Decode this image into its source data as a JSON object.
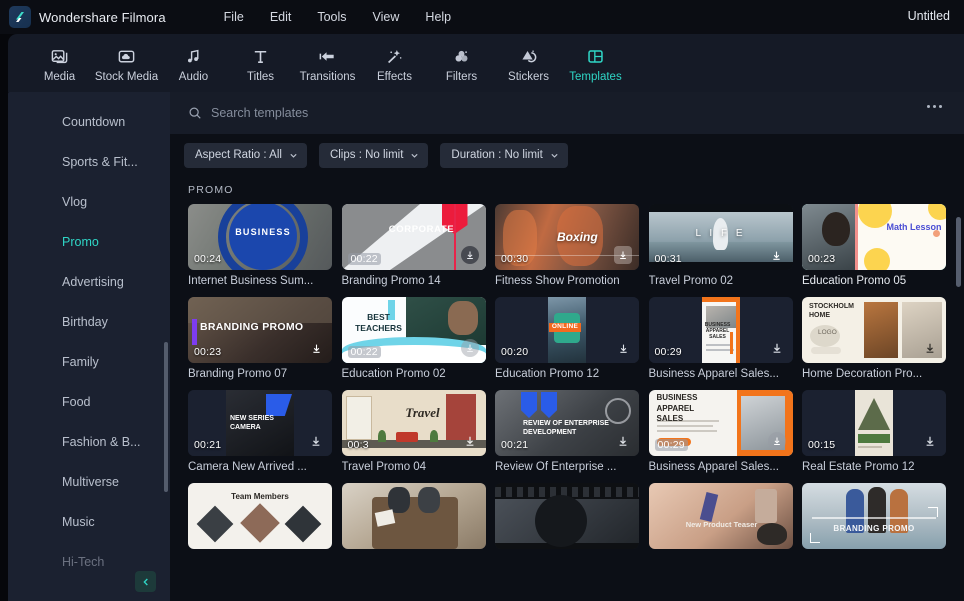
{
  "titlebar": {
    "app_name": "Wondershare Filmora",
    "logo_icon": "filmora-logo-icon",
    "menus": [
      "File",
      "Edit",
      "Tools",
      "View",
      "Help"
    ],
    "project_title": "Untitled"
  },
  "toolbar": {
    "items": [
      {
        "label": "Media",
        "icon": "media-image-icon",
        "active": false
      },
      {
        "label": "Stock Media",
        "icon": "stock-media-cloud-icon",
        "active": false
      },
      {
        "label": "Audio",
        "icon": "audio-note-icon",
        "active": false
      },
      {
        "label": "Titles",
        "icon": "titles-text-icon",
        "active": false
      },
      {
        "label": "Transitions",
        "icon": "transitions-arrow-icon",
        "active": false
      },
      {
        "label": "Effects",
        "icon": "effects-wand-icon",
        "active": false
      },
      {
        "label": "Filters",
        "icon": "filters-circles-icon",
        "active": false
      },
      {
        "label": "Stickers",
        "icon": "stickers-icon",
        "active": false
      },
      {
        "label": "Templates",
        "icon": "templates-layout-icon",
        "active": true
      }
    ],
    "active_index": 8
  },
  "sidebar": {
    "items": [
      {
        "label": "Countdown",
        "active": false,
        "faded": false
      },
      {
        "label": "Sports & Fit...",
        "active": false,
        "faded": false
      },
      {
        "label": "Vlog",
        "active": false,
        "faded": false
      },
      {
        "label": "Promo",
        "active": true,
        "faded": false
      },
      {
        "label": "Advertising",
        "active": false,
        "faded": false
      },
      {
        "label": "Birthday",
        "active": false,
        "faded": false
      },
      {
        "label": "Family",
        "active": false,
        "faded": false
      },
      {
        "label": "Food",
        "active": false,
        "faded": false
      },
      {
        "label": "Fashion & B...",
        "active": false,
        "faded": false
      },
      {
        "label": "Multiverse",
        "active": false,
        "faded": false
      },
      {
        "label": "Music",
        "active": false,
        "faded": false
      },
      {
        "label": "Hi-Tech",
        "active": false,
        "faded": true
      }
    ],
    "collapse_icon": "chevron-left-icon"
  },
  "search": {
    "placeholder": "Search templates",
    "value": "",
    "icon": "search-icon",
    "more_icon": "more-options-icon"
  },
  "filters": [
    {
      "label": "Aspect Ratio : All",
      "icon": "chevron-down-icon"
    },
    {
      "label": "Clips : No limit",
      "icon": "chevron-down-icon"
    },
    {
      "label": "Duration : No limit",
      "icon": "chevron-down-icon"
    }
  ],
  "grid": {
    "section_label": "PROMO",
    "download_icon": "download-icon",
    "cards": [
      {
        "title": "Internet Business Sum...",
        "duration": "00:24",
        "selected": false,
        "has_download": false,
        "boxed": false,
        "art": "business-circle",
        "caption": "BUSINESS"
      },
      {
        "title": "Branding Promo 14",
        "duration": "00:22",
        "selected": false,
        "has_download": true,
        "boxed": true,
        "art": "corporate",
        "caption": "CORPORATE"
      },
      {
        "title": "Fitness Show Promotion",
        "duration": "00:30",
        "selected": false,
        "has_download": true,
        "boxed": false,
        "art": "boxing",
        "caption": "Boxing"
      },
      {
        "title": "Travel Promo 02",
        "duration": "00:31",
        "selected": false,
        "has_download": true,
        "boxed": false,
        "art": "life",
        "caption": "L I F E"
      },
      {
        "title": "Education Promo 05",
        "duration": "00:23",
        "selected": true,
        "has_download": false,
        "boxed": false,
        "art": "math-lesson",
        "caption": "Math Lesson"
      },
      {
        "title": "Branding Promo 07",
        "duration": "00:23",
        "selected": false,
        "has_download": true,
        "boxed": false,
        "art": "branding-promo",
        "caption": "BRANDING PROMO"
      },
      {
        "title": "Education Promo 02",
        "duration": "00:22",
        "selected": false,
        "has_download": true,
        "boxed": true,
        "art": "best-teachers",
        "caption": "BEST TEACHERS"
      },
      {
        "title": "Education Promo 12",
        "duration": "00:20",
        "selected": false,
        "has_download": true,
        "boxed": false,
        "art": "online-vertical",
        "caption": "ONLINE"
      },
      {
        "title": "Business Apparel Sales...",
        "duration": "00:29",
        "selected": false,
        "has_download": true,
        "boxed": false,
        "art": "apparel-vertical",
        "caption": "BUSINESS APPAREL SALES"
      },
      {
        "title": "Home Decoration Pro...",
        "duration": "",
        "selected": false,
        "has_download": true,
        "boxed": false,
        "art": "stockholm-home",
        "caption": "STOCKHOLM HOME"
      },
      {
        "title": "Camera New Arrived ...",
        "duration": "00:21",
        "selected": false,
        "has_download": true,
        "boxed": false,
        "art": "new-series-camera",
        "caption": "NEW SERIES CAMERA"
      },
      {
        "title": "Travel Promo 04",
        "duration": "00:3",
        "selected": false,
        "has_download": true,
        "boxed": false,
        "art": "travel-illustration",
        "caption": "Travel"
      },
      {
        "title": "Review Of Enterprise ...",
        "duration": "00:21",
        "selected": false,
        "has_download": true,
        "boxed": false,
        "art": "enterprise-review",
        "caption": "REVIEW OF ENTERPRISE DEVELOPMENT"
      },
      {
        "title": "Business Apparel Sales...",
        "duration": "00:29",
        "selected": false,
        "has_download": true,
        "boxed": true,
        "art": "apparel-sales",
        "caption": "BUSINESS APPAREL SALES"
      },
      {
        "title": "Real Estate Promo 12",
        "duration": "00:15",
        "selected": false,
        "has_download": true,
        "boxed": false,
        "art": "real-estate-vertical",
        "caption": ""
      },
      {
        "title": "",
        "duration": "",
        "selected": false,
        "has_download": false,
        "boxed": false,
        "art": "team-members",
        "caption": "Team Members"
      },
      {
        "title": "",
        "duration": "",
        "selected": false,
        "has_download": false,
        "boxed": false,
        "art": "meeting-table",
        "caption": ""
      },
      {
        "title": "",
        "duration": "",
        "selected": false,
        "has_download": false,
        "boxed": false,
        "art": "film-strip",
        "caption": ""
      },
      {
        "title": "",
        "duration": "",
        "selected": false,
        "has_download": false,
        "boxed": false,
        "art": "product-teaser",
        "caption": "New Product Teaser"
      },
      {
        "title": "",
        "duration": "",
        "selected": false,
        "has_download": false,
        "boxed": false,
        "art": "branding-people",
        "caption": "BRANDING PROMO"
      }
    ]
  },
  "colors": {
    "accent": "#2fd6c6",
    "titlebar_bg": "#0b0d13",
    "toolbar_bg": "#151a26",
    "sidebar_bg": "#1b2130",
    "content_bg": "#0c0f16",
    "search_bg": "#171c28",
    "chip_bg": "#252b38"
  }
}
